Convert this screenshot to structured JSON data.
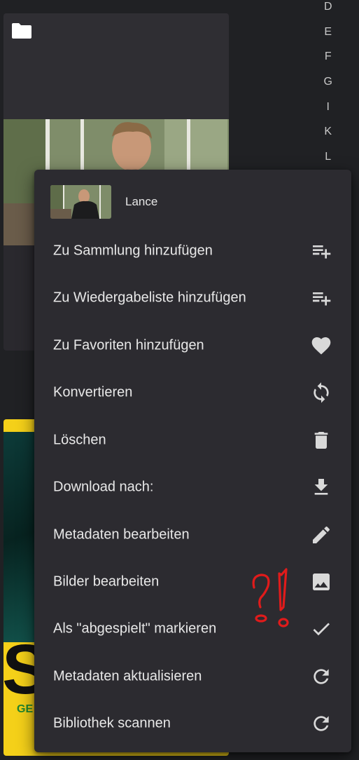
{
  "alphabet_index": [
    "D",
    "E",
    "F",
    "G",
    "I",
    "K",
    "L"
  ],
  "menu": {
    "title": "Lance",
    "items": [
      {
        "label": "Zu Sammlung hinzufügen",
        "icon": "playlist-add-icon"
      },
      {
        "label": "Zu Wiedergabeliste hinzufügen",
        "icon": "playlist-add-icon"
      },
      {
        "label": "Zu Favoriten hinzufügen",
        "icon": "heart-icon"
      },
      {
        "label": "Konvertieren",
        "icon": "sync-icon"
      },
      {
        "label": "Löschen",
        "icon": "trash-icon"
      },
      {
        "label": "Download nach:",
        "icon": "download-icon"
      },
      {
        "label": "Metadaten bearbeiten",
        "icon": "pencil-icon"
      },
      {
        "label": "Bilder bearbeiten",
        "icon": "image-icon"
      },
      {
        "label": "Als \"abgespielt\" markieren",
        "icon": "check-icon"
      },
      {
        "label": "Metadaten aktualisieren",
        "icon": "refresh-icon"
      },
      {
        "label": "Bibliothek scannen",
        "icon": "refresh-icon"
      }
    ]
  },
  "poster": {
    "big_letter": "S",
    "subtitle_fragment": "GE"
  },
  "annotation": {
    "text": "?!",
    "color": "#e01b1b"
  },
  "colors": {
    "menu_bg": "#2c2b30",
    "page_bg": "#202124",
    "icon": "#d9d9d9"
  }
}
